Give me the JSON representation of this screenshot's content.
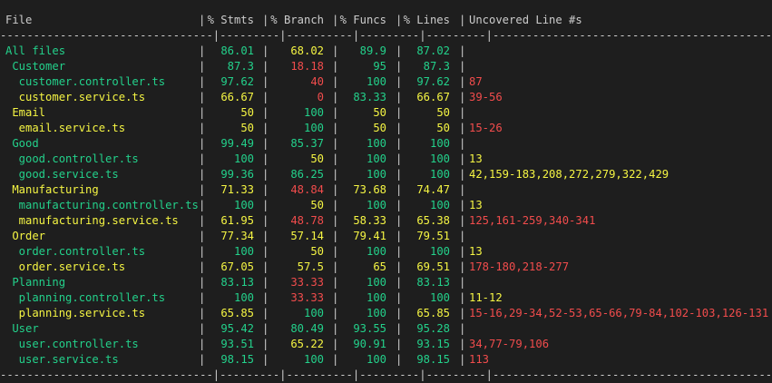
{
  "colors": {
    "background": "#1e1e1e",
    "text": "#cccccc",
    "green": "#23d18b",
    "yellow": "#f5f543",
    "red": "#f14c4c"
  },
  "header": {
    "file": "File",
    "stmts": "% Stmts",
    "branch": "% Branch",
    "funcs": "% Funcs",
    "lines": "% Lines",
    "uncovered": "Uncovered Line #s"
  },
  "divider": "--------------------------------|---------|----------|---------|---------|--------------------------------------------------",
  "rows": [
    {
      "file": "All files",
      "stmts": "86.01",
      "branch": "68.02",
      "funcs": "89.9",
      "lines": "87.02",
      "uncovered": "",
      "c_file": "green",
      "c_stmts": "green",
      "c_branch": "yellow",
      "c_funcs": "green",
      "c_lines": "green",
      "c_unc": "red"
    },
    {
      "file": " Customer",
      "stmts": "87.3",
      "branch": "18.18",
      "funcs": "95",
      "lines": "87.3",
      "uncovered": "",
      "c_file": "green",
      "c_stmts": "green",
      "c_branch": "red",
      "c_funcs": "green",
      "c_lines": "green",
      "c_unc": "red"
    },
    {
      "file": "  customer.controller.ts",
      "stmts": "97.62",
      "branch": "40",
      "funcs": "100",
      "lines": "97.62",
      "uncovered": "87",
      "c_file": "green",
      "c_stmts": "green",
      "c_branch": "red",
      "c_funcs": "green",
      "c_lines": "green",
      "c_unc": "red"
    },
    {
      "file": "  customer.service.ts",
      "stmts": "66.67",
      "branch": "0",
      "funcs": "83.33",
      "lines": "66.67",
      "uncovered": "39-56",
      "c_file": "yellow",
      "c_stmts": "yellow",
      "c_branch": "red",
      "c_funcs": "green",
      "c_lines": "yellow",
      "c_unc": "red"
    },
    {
      "file": " Email",
      "stmts": "50",
      "branch": "100",
      "funcs": "50",
      "lines": "50",
      "uncovered": "",
      "c_file": "yellow",
      "c_stmts": "yellow",
      "c_branch": "green",
      "c_funcs": "yellow",
      "c_lines": "yellow",
      "c_unc": "red"
    },
    {
      "file": "  email.service.ts",
      "stmts": "50",
      "branch": "100",
      "funcs": "50",
      "lines": "50",
      "uncovered": "15-26",
      "c_file": "yellow",
      "c_stmts": "yellow",
      "c_branch": "green",
      "c_funcs": "yellow",
      "c_lines": "yellow",
      "c_unc": "red"
    },
    {
      "file": " Good",
      "stmts": "99.49",
      "branch": "85.37",
      "funcs": "100",
      "lines": "100",
      "uncovered": "",
      "c_file": "green",
      "c_stmts": "green",
      "c_branch": "green",
      "c_funcs": "green",
      "c_lines": "green",
      "c_unc": "red"
    },
    {
      "file": "  good.controller.ts",
      "stmts": "100",
      "branch": "50",
      "funcs": "100",
      "lines": "100",
      "uncovered": "13",
      "c_file": "green",
      "c_stmts": "green",
      "c_branch": "yellow",
      "c_funcs": "green",
      "c_lines": "green",
      "c_unc": "yellow"
    },
    {
      "file": "  good.service.ts",
      "stmts": "99.36",
      "branch": "86.25",
      "funcs": "100",
      "lines": "100",
      "uncovered": "42,159-183,208,272,279,322,429",
      "c_file": "green",
      "c_stmts": "green",
      "c_branch": "green",
      "c_funcs": "green",
      "c_lines": "green",
      "c_unc": "yellow"
    },
    {
      "file": " Manufacturing",
      "stmts": "71.33",
      "branch": "48.84",
      "funcs": "73.68",
      "lines": "74.47",
      "uncovered": "",
      "c_file": "yellow",
      "c_stmts": "yellow",
      "c_branch": "red",
      "c_funcs": "yellow",
      "c_lines": "yellow",
      "c_unc": "red"
    },
    {
      "file": "  manufacturing.controller.ts",
      "stmts": "100",
      "branch": "50",
      "funcs": "100",
      "lines": "100",
      "uncovered": "13",
      "c_file": "green",
      "c_stmts": "green",
      "c_branch": "yellow",
      "c_funcs": "green",
      "c_lines": "green",
      "c_unc": "yellow"
    },
    {
      "file": "  manufacturing.service.ts",
      "stmts": "61.95",
      "branch": "48.78",
      "funcs": "58.33",
      "lines": "65.38",
      "uncovered": "125,161-259,340-341",
      "c_file": "yellow",
      "c_stmts": "yellow",
      "c_branch": "red",
      "c_funcs": "yellow",
      "c_lines": "yellow",
      "c_unc": "red"
    },
    {
      "file": " Order",
      "stmts": "77.34",
      "branch": "57.14",
      "funcs": "79.41",
      "lines": "79.51",
      "uncovered": "",
      "c_file": "yellow",
      "c_stmts": "yellow",
      "c_branch": "yellow",
      "c_funcs": "yellow",
      "c_lines": "yellow",
      "c_unc": "red"
    },
    {
      "file": "  order.controller.ts",
      "stmts": "100",
      "branch": "50",
      "funcs": "100",
      "lines": "100",
      "uncovered": "13",
      "c_file": "green",
      "c_stmts": "green",
      "c_branch": "yellow",
      "c_funcs": "green",
      "c_lines": "green",
      "c_unc": "yellow"
    },
    {
      "file": "  order.service.ts",
      "stmts": "67.05",
      "branch": "57.5",
      "funcs": "65",
      "lines": "69.51",
      "uncovered": "178-180,218-277",
      "c_file": "yellow",
      "c_stmts": "yellow",
      "c_branch": "yellow",
      "c_funcs": "yellow",
      "c_lines": "yellow",
      "c_unc": "red"
    },
    {
      "file": " Planning",
      "stmts": "83.13",
      "branch": "33.33",
      "funcs": "100",
      "lines": "83.13",
      "uncovered": "",
      "c_file": "green",
      "c_stmts": "green",
      "c_branch": "red",
      "c_funcs": "green",
      "c_lines": "green",
      "c_unc": "red"
    },
    {
      "file": "  planning.controller.ts",
      "stmts": "100",
      "branch": "33.33",
      "funcs": "100",
      "lines": "100",
      "uncovered": "11-12",
      "c_file": "green",
      "c_stmts": "green",
      "c_branch": "red",
      "c_funcs": "green",
      "c_lines": "green",
      "c_unc": "yellow"
    },
    {
      "file": "  planning.service.ts",
      "stmts": "65.85",
      "branch": "100",
      "funcs": "100",
      "lines": "65.85",
      "uncovered": "15-16,29-34,52-53,65-66,79-84,102-103,126-131",
      "c_file": "yellow",
      "c_stmts": "yellow",
      "c_branch": "green",
      "c_funcs": "green",
      "c_lines": "yellow",
      "c_unc": "red"
    },
    {
      "file": " User",
      "stmts": "95.42",
      "branch": "80.49",
      "funcs": "93.55",
      "lines": "95.28",
      "uncovered": "",
      "c_file": "green",
      "c_stmts": "green",
      "c_branch": "green",
      "c_funcs": "green",
      "c_lines": "green",
      "c_unc": "red"
    },
    {
      "file": "  user.controller.ts",
      "stmts": "93.51",
      "branch": "65.22",
      "funcs": "90.91",
      "lines": "93.15",
      "uncovered": "34,77-79,106",
      "c_file": "green",
      "c_stmts": "green",
      "c_branch": "yellow",
      "c_funcs": "green",
      "c_lines": "green",
      "c_unc": "red"
    },
    {
      "file": "  user.service.ts",
      "stmts": "98.15",
      "branch": "100",
      "funcs": "100",
      "lines": "98.15",
      "uncovered": "113",
      "c_file": "green",
      "c_stmts": "green",
      "c_branch": "green",
      "c_funcs": "green",
      "c_lines": "green",
      "c_unc": "red"
    }
  ]
}
